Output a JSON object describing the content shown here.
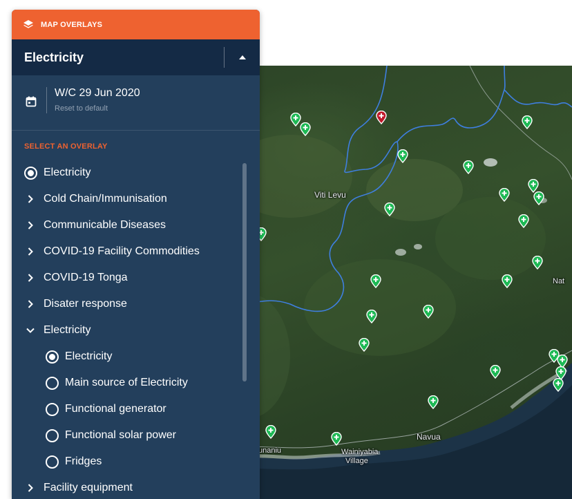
{
  "panel": {
    "header_title": "MAP OVERLAYS",
    "selected_overlay": "Electricity",
    "date_label": "W/C 29 Jun 2020",
    "reset_label": "Reset to default",
    "section_label": "SELECT AN OVERLAY",
    "items": [
      {
        "label": "Electricity",
        "type": "radio",
        "selected": true
      },
      {
        "label": "Cold Chain/Immunisation",
        "type": "group",
        "expanded": false
      },
      {
        "label": "Communicable Diseases",
        "type": "group",
        "expanded": false
      },
      {
        "label": "COVID-19 Facility Commodities",
        "type": "group",
        "expanded": false
      },
      {
        "label": "COVID-19  Tonga",
        "type": "group",
        "expanded": false
      },
      {
        "label": "Disater response",
        "type": "group",
        "expanded": false
      },
      {
        "label": "Electricity",
        "type": "group",
        "expanded": true
      },
      {
        "label": "Electricity",
        "type": "radio",
        "selected": true,
        "level": 1
      },
      {
        "label": "Main source of Electricity",
        "type": "radio",
        "selected": false,
        "level": 1
      },
      {
        "label": "Functional generator",
        "type": "radio",
        "selected": false,
        "level": 1
      },
      {
        "label": "Functional solar power",
        "type": "radio",
        "selected": false,
        "level": 1
      },
      {
        "label": "Fridges",
        "type": "radio",
        "selected": false,
        "level": 1
      },
      {
        "label": "Facility equipment",
        "type": "group",
        "expanded": false
      }
    ]
  },
  "map": {
    "labels": {
      "island": "Viti Levu",
      "navua": "Navua",
      "village_a": "Wainiyabia",
      "village_b": "Village",
      "left_edge": "unaniu",
      "right_edge": "Nat"
    }
  },
  "colors": {
    "header_orange": "#ee6230",
    "panel_navy": "#233f5c",
    "selected_bar": "#142a45",
    "pin_green": "#1db954",
    "pin_red": "#c0182a",
    "boundary_blue": "#3f7fe0"
  }
}
